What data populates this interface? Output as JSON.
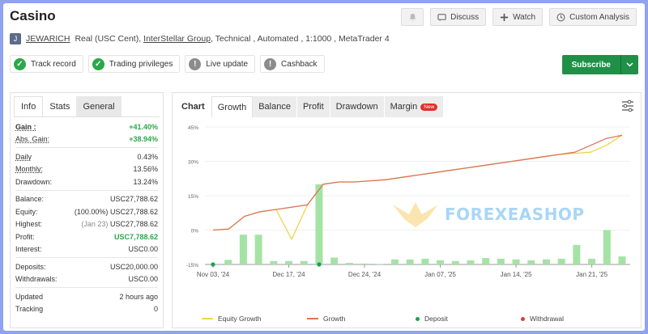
{
  "header": {
    "title": "Casino"
  },
  "actions": {
    "discuss": "Discuss",
    "watch": "Watch",
    "custom_analysis": "Custom Analysis"
  },
  "author": {
    "initial": "J",
    "name": "JEWARICH",
    "account_type": "Real (USC Cent),",
    "broker": "InterStellar Group",
    "details": ", Technical , Automated , 1:1000 , MetaTrader 4"
  },
  "badges": [
    {
      "label": "Track record",
      "status": "ok"
    },
    {
      "label": "Trading privileges",
      "status": "ok"
    },
    {
      "label": "Live update",
      "status": "warn"
    },
    {
      "label": "Cashback",
      "status": "warn"
    }
  ],
  "subscribe": "Subscribe",
  "left_tabs": [
    "Info",
    "Stats",
    "General"
  ],
  "stats": {
    "gain_label": "Gain :",
    "gain": "+41.40%",
    "abs_gain_label": "Abs. Gain:",
    "abs_gain": "+38.94%",
    "daily_label": "Daily",
    "daily": "0.43%",
    "monthly_label": "Monthly:",
    "monthly": "13.56%",
    "drawdown_label": "Drawdown:",
    "drawdown": "13.24%",
    "balance_label": "Balance:",
    "balance": "USC27,788.62",
    "equity_label": "Equity:",
    "equity_pct": "(100.00%)",
    "equity": "USC27,788.62",
    "highest_label": "Highest:",
    "highest_date": "(Jan 23)",
    "highest": "USC27,788.62",
    "profit_label": "Profit:",
    "profit": "USC7,788.62",
    "interest_label": "Interest:",
    "interest": "USC0.00",
    "deposits_label": "Deposits:",
    "deposits": "USC20,000.00",
    "withdrawals_label": "Withdrawals:",
    "withdrawals": "USC0.00",
    "updated_label": "Updated",
    "updated": "2 hours ago",
    "tracking_label": "Tracking",
    "tracking": "0"
  },
  "chart_tabs": [
    "Chart",
    "Growth",
    "Balance",
    "Profit",
    "Drawdown",
    "Margin"
  ],
  "chart_new_badge": "New",
  "watermark": "FOREXEASHOP",
  "colors": {
    "equity": "#f0d44a",
    "growth": "#d9765a",
    "bars": "#a5e3a5",
    "deposit": "#16a34a",
    "withdrawal": "#e03b3b",
    "accent": "#1f9047"
  },
  "chart_data": {
    "type": "line",
    "y_ticks": [
      "45%",
      "30%",
      "15%",
      "0%",
      "-15%"
    ],
    "ylim": [
      -15,
      45
    ],
    "x_ticks": [
      "Nov 03, '24",
      "Dec 17, '24",
      "Dec 24, '24",
      "Jan 07, '25",
      "Jan 14, '25",
      "Jan 21, '25"
    ],
    "legend": [
      "Equity Growth",
      "Growth",
      "Deposit",
      "Withdrawal"
    ],
    "series": [
      {
        "name": "Growth",
        "x": [
          0,
          1,
          2,
          3,
          4,
          5,
          6,
          7,
          8,
          9,
          10,
          11,
          12,
          13,
          14,
          15,
          16,
          17,
          18,
          19,
          20,
          21,
          22,
          23,
          24,
          25,
          26
        ],
        "values": [
          0,
          0.5,
          6,
          8,
          9,
          10,
          11,
          20,
          21,
          21,
          21.5,
          22,
          23,
          24,
          25,
          26,
          27,
          28,
          29,
          30,
          31,
          32,
          33,
          34,
          37,
          40,
          41.4
        ]
      },
      {
        "name": "Equity Growth",
        "x": [
          0,
          1,
          2,
          3,
          4,
          5,
          6,
          7,
          8,
          9,
          10,
          11,
          12,
          13,
          14,
          15,
          16,
          17,
          18,
          19,
          20,
          21,
          22,
          23,
          24,
          25,
          26
        ],
        "values": [
          0,
          0.5,
          6,
          8,
          9,
          -4,
          11,
          20,
          21,
          21,
          21.5,
          22,
          23,
          24,
          25,
          26,
          27,
          28,
          29,
          30,
          31,
          32,
          33,
          33.5,
          34,
          37,
          41.4
        ]
      }
    ],
    "bars": [
      0,
      2,
      13,
      13,
      1.5,
      1.5,
      1.5,
      35,
      3,
      0.7,
      0.4,
      0.2,
      2.2,
      2.2,
      2.5,
      1.8,
      1.5,
      1.8,
      2.8,
      2.5,
      2.2,
      1.8,
      2.2,
      2.5,
      8.5,
      2.5,
      15,
      3.5
    ],
    "deposit_points": [
      0,
      7
    ]
  }
}
